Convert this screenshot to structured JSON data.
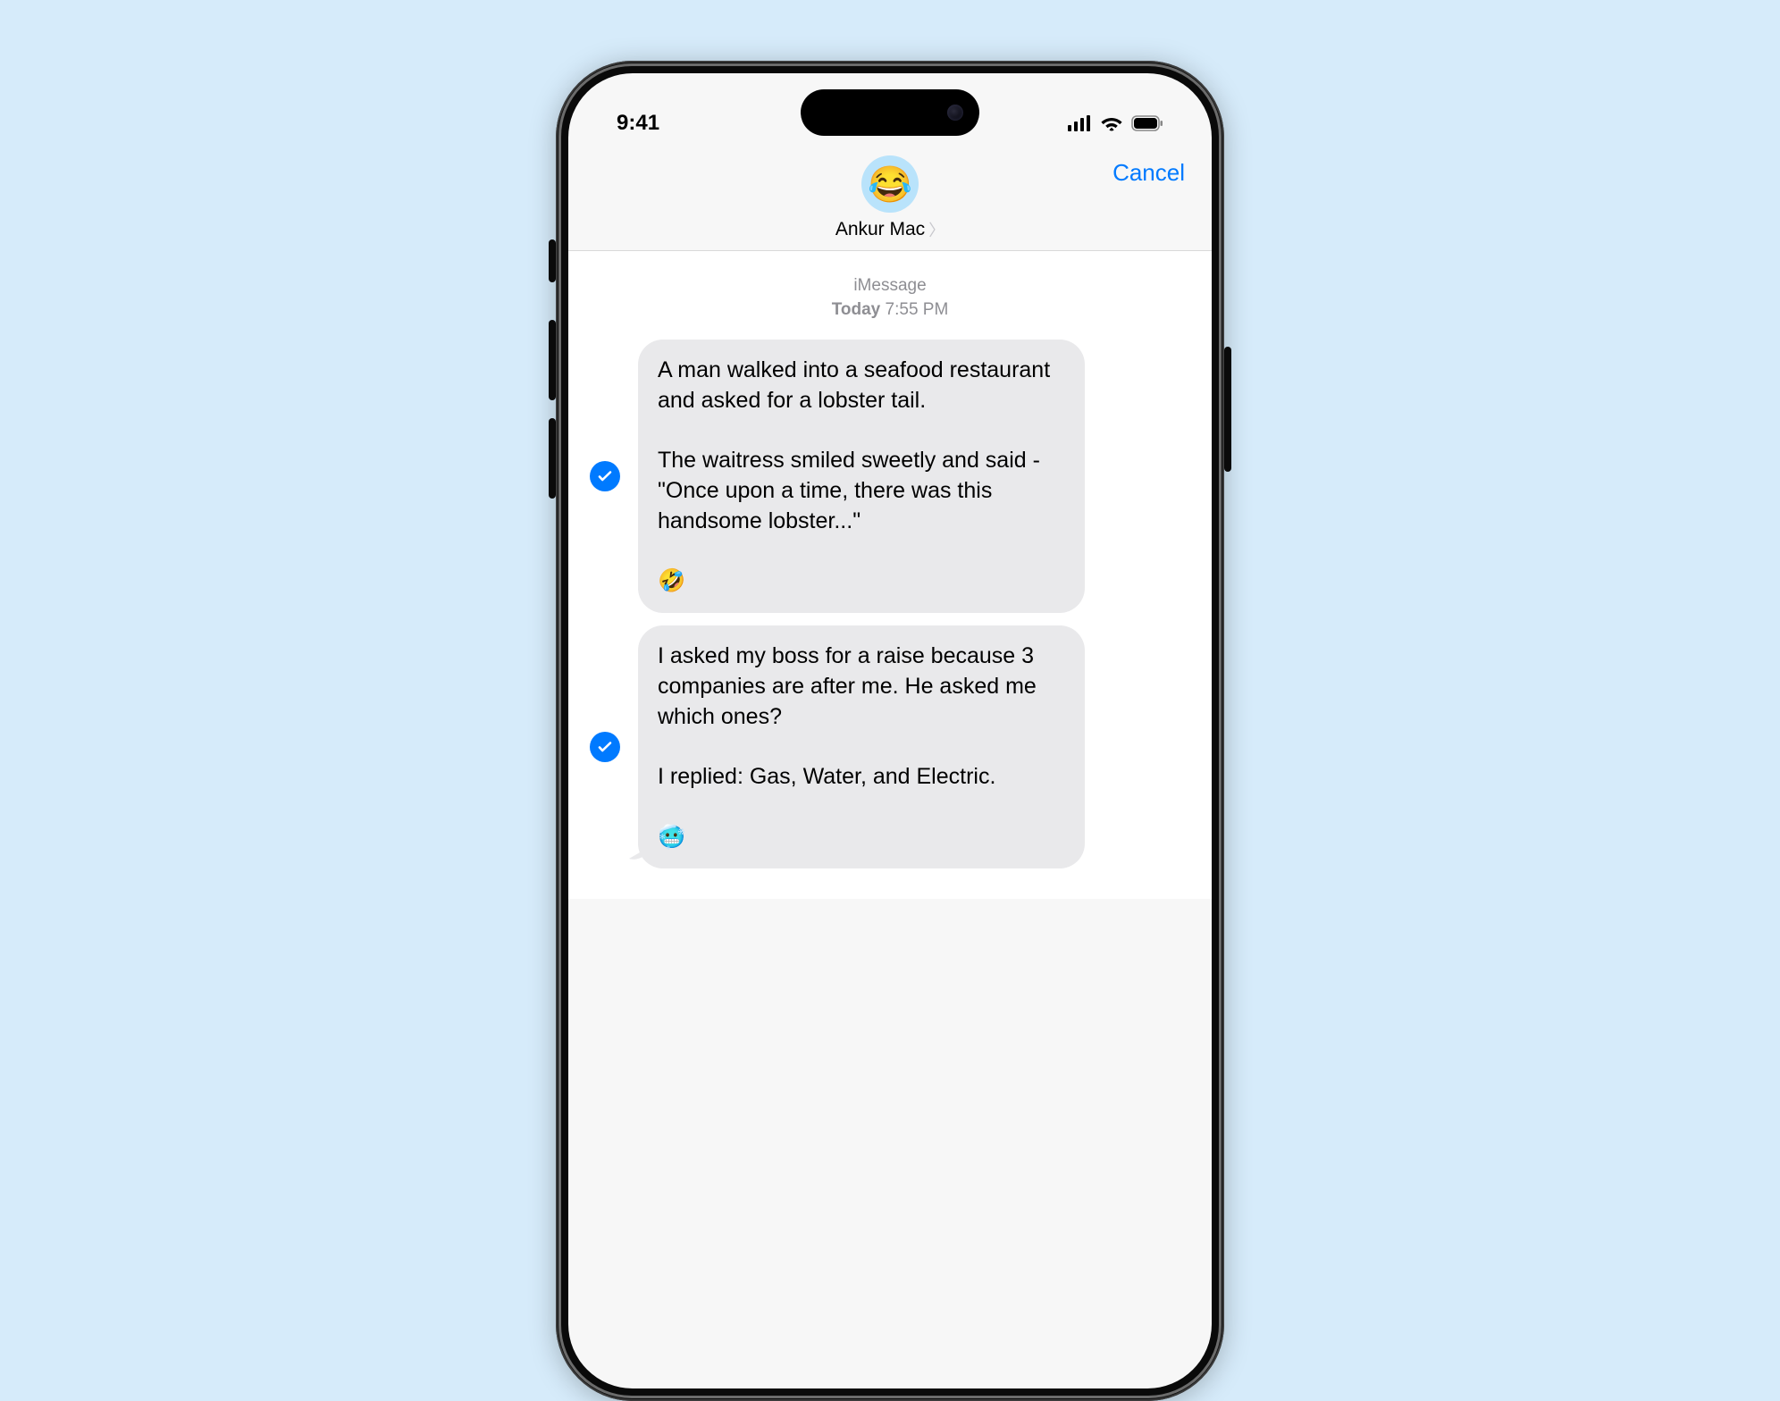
{
  "statusbar": {
    "time": "9:41"
  },
  "header": {
    "avatar_emoji": "😂",
    "contact_name": "Ankur Mac",
    "cancel_label": "Cancel"
  },
  "thread": {
    "service_label": "iMessage",
    "day_label": "Today",
    "time_label": "7:55 PM",
    "messages": [
      {
        "selected": true,
        "text": "A man walked into a seafood restaurant and asked for a lobster tail.\n\nThe waitress smiled sweetly and said - \"Once upon a time, there was this handsome lobster...\"\n\n🤣"
      },
      {
        "selected": true,
        "text": "I asked my boss for a raise because 3 companies are after me. He asked me which ones?\n\nI replied: Gas, Water, and Electric.\n\n🥶"
      }
    ]
  }
}
